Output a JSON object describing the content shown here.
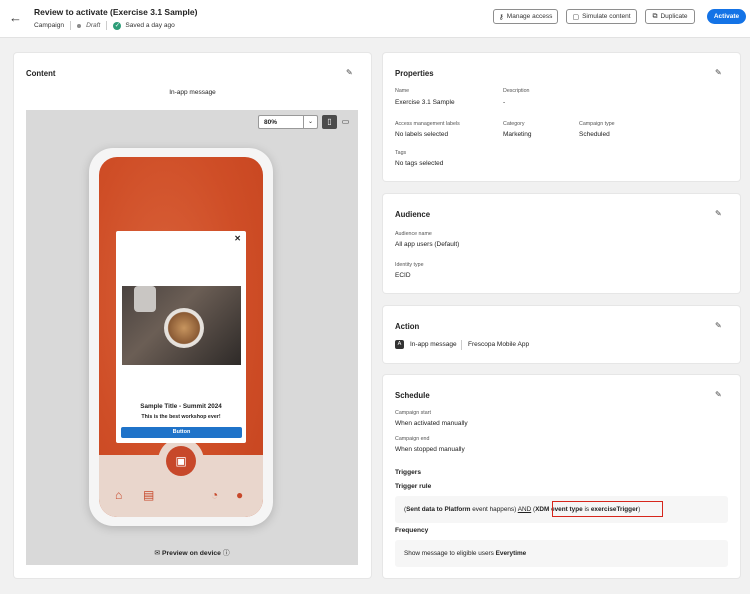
{
  "header": {
    "title": "Review to activate (Exercise 3.1 Sample)",
    "type": "Campaign",
    "status": "Draft",
    "saved": "Saved a day ago",
    "buttons": {
      "manage_access": "Manage access",
      "simulate": "Simulate content",
      "duplicate": "Duplicate",
      "activate": "Activate"
    }
  },
  "content": {
    "title": "Content",
    "channel": "In-app message",
    "zoom": "80%",
    "message": {
      "title": "Sample Title - Summit 2024",
      "text": "This is the best workshop ever!",
      "button": "Button"
    },
    "preview_link": "Preview on device"
  },
  "properties": {
    "title": "Properties",
    "name_label": "Name",
    "name": "Exercise 3.1 Sample",
    "description_label": "Description",
    "description": "-",
    "access_label": "Access management labels",
    "access": "No labels selected",
    "category_label": "Category",
    "category": "Marketing",
    "campaign_type_label": "Campaign type",
    "campaign_type": "Scheduled",
    "tags_label": "Tags",
    "tags": "No tags selected"
  },
  "audience": {
    "title": "Audience",
    "name_label": "Audience name",
    "name": "All app users (Default)",
    "identity_label": "Identity type",
    "identity": "ECID"
  },
  "action": {
    "title": "Action",
    "channel": "In-app message",
    "app": "Frescopa Mobile App"
  },
  "schedule": {
    "title": "Schedule",
    "start_label": "Campaign start",
    "start": "When activated manually",
    "end_label": "Campaign end",
    "end": "When stopped manually",
    "triggers": "Triggers",
    "trigger_rule_label": "Trigger rule",
    "rule": {
      "open": "(",
      "part1_bold": "Sent data to Platform",
      "part1": " event happens) ",
      "and": "AND",
      "part2_open": " (",
      "part2_bold": "XDM event type",
      "is": " is ",
      "part2_value": "exerciseTrigger",
      "close": ")"
    },
    "frequency_label": "Frequency",
    "frequency_text": "Show message to eligible users ",
    "frequency_value": "Everytime"
  },
  "colors": {
    "accent": "#1473e6",
    "highlight": "#d6261c",
    "phone_bg": "#cf4e27"
  }
}
